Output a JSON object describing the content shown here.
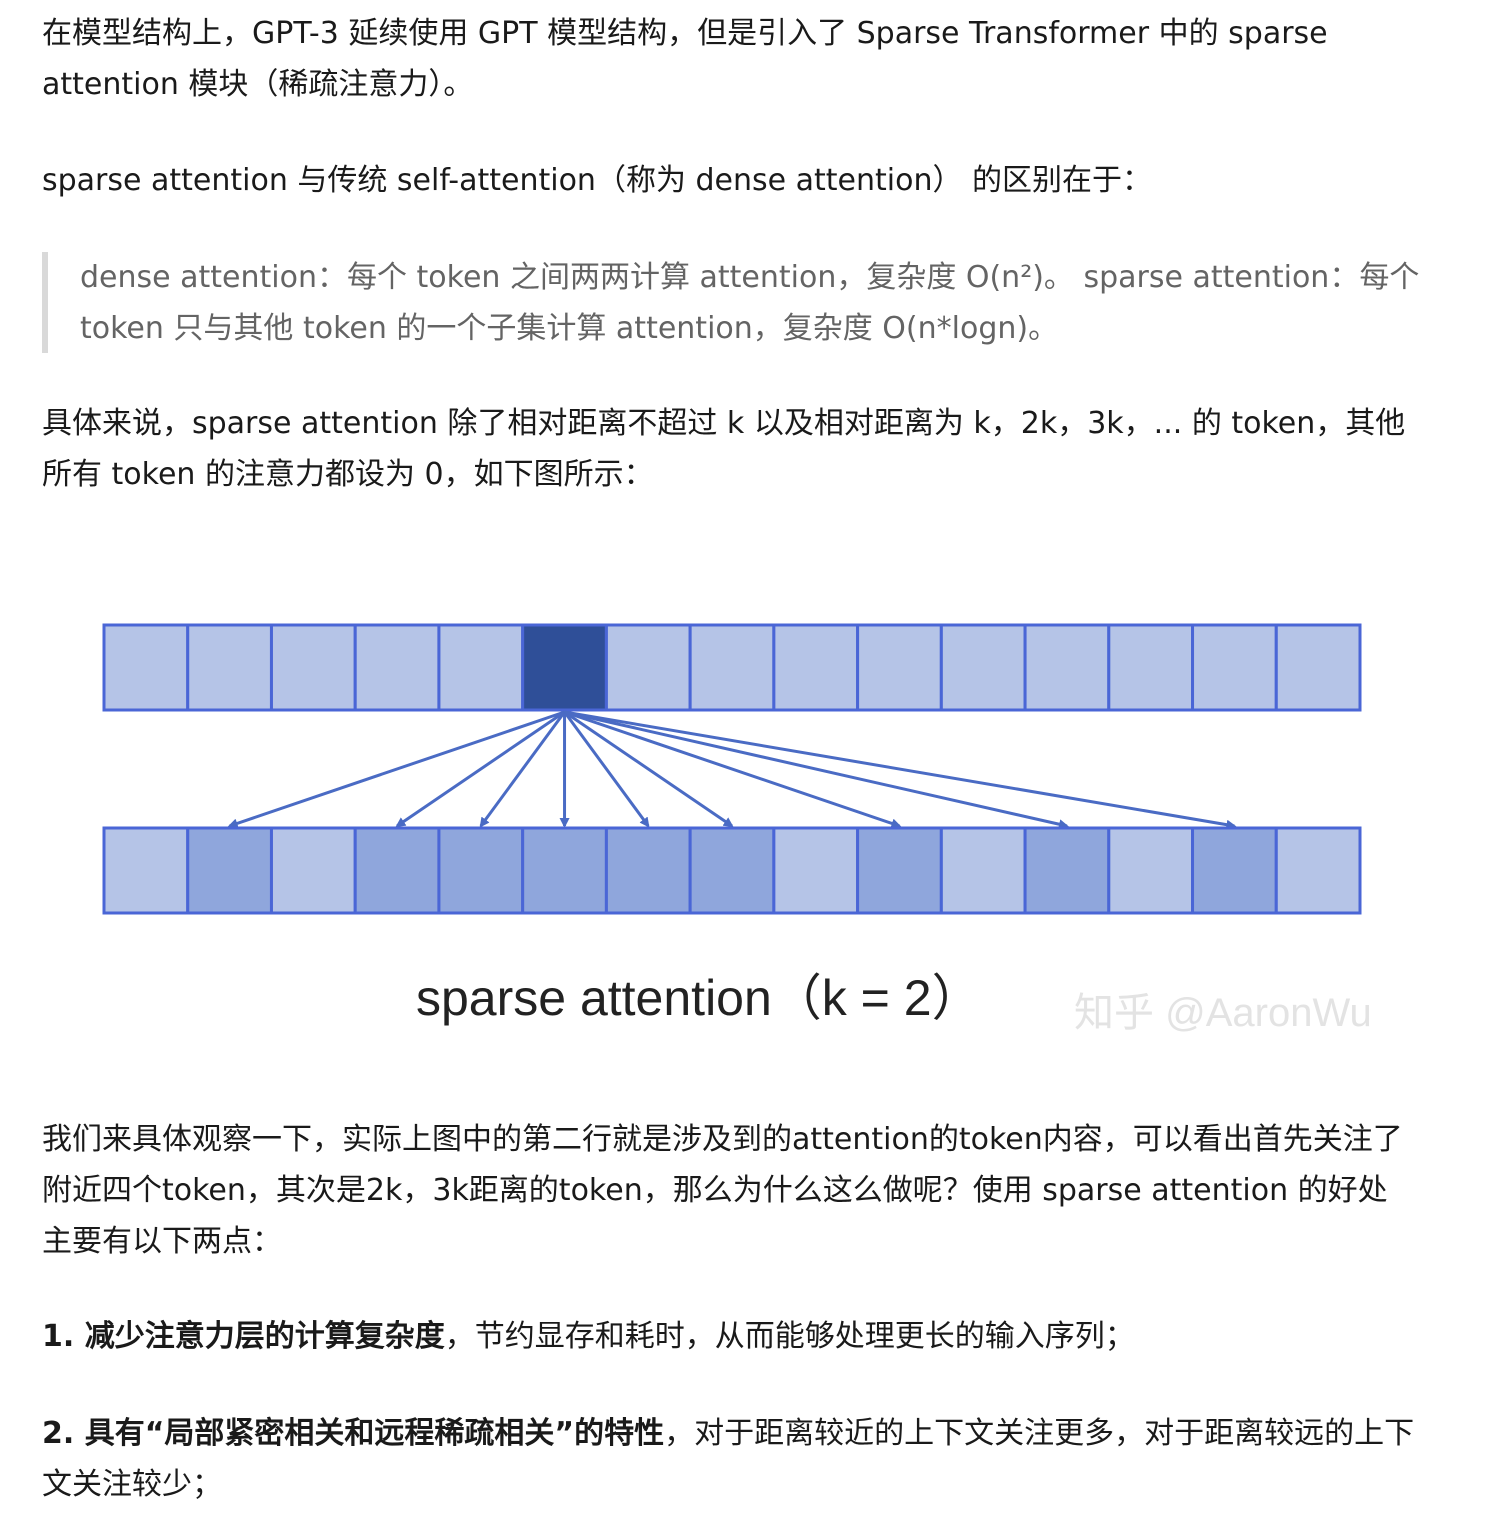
{
  "paragraphs": {
    "p1": "在模型结构上，GPT-3 延续使用 GPT 模型结构，但是引入了 Sparse Transformer 中的 sparse attention 模块（稀疏注意力）。",
    "p2": "sparse attention 与传统 self-attention（称为 dense attention） 的区别在于：",
    "quote": "dense attention：每个 token 之间两两计算 attention，复杂度 O(n²)。 sparse attention：每个 token 只与其他 token 的一个子集计算 attention，复杂度 O(n*logn)。",
    "p3": "具体来说，sparse attention 除了相对距离不超过 k 以及相对距离为 k，2k，3k，... 的 token，其他所有 token 的注意力都设为 0，如下图所示：",
    "p4": "我们来具体观察一下，实际上图中的第二行就是涉及到的attention的token内容，可以看出首先关注了附近四个token，其次是2k，3k距离的token，那么为什么这么做呢？使用 sparse attention 的好处主要有以下两点：",
    "item1_bold": "1. 减少注意力层的计算复杂度",
    "item1_rest": "，节约显存和耗时，从而能够处理更长的输入序列；",
    "item2_bold": "2. 具有“局部紧密相关和远程稀疏相关”的特性",
    "item2_rest": "，对于距离较近的上下文关注更多，对于距离较远的上下文关注较少；"
  },
  "figure": {
    "caption": "sparse attention（k = 2）",
    "watermark": "知乎 @AaronWu",
    "cells_per_row": 15,
    "query_index": 5,
    "attended_indices": [
      1,
      3,
      4,
      5,
      6,
      7,
      9,
      11,
      13
    ],
    "colors": {
      "cell_fill": "#b5c4e7",
      "cell_stroke": "#4a66d6",
      "query_fill": "#2f4f98",
      "attended_fill": "#8fa6dc",
      "arrow": "#4a6bc4"
    }
  }
}
